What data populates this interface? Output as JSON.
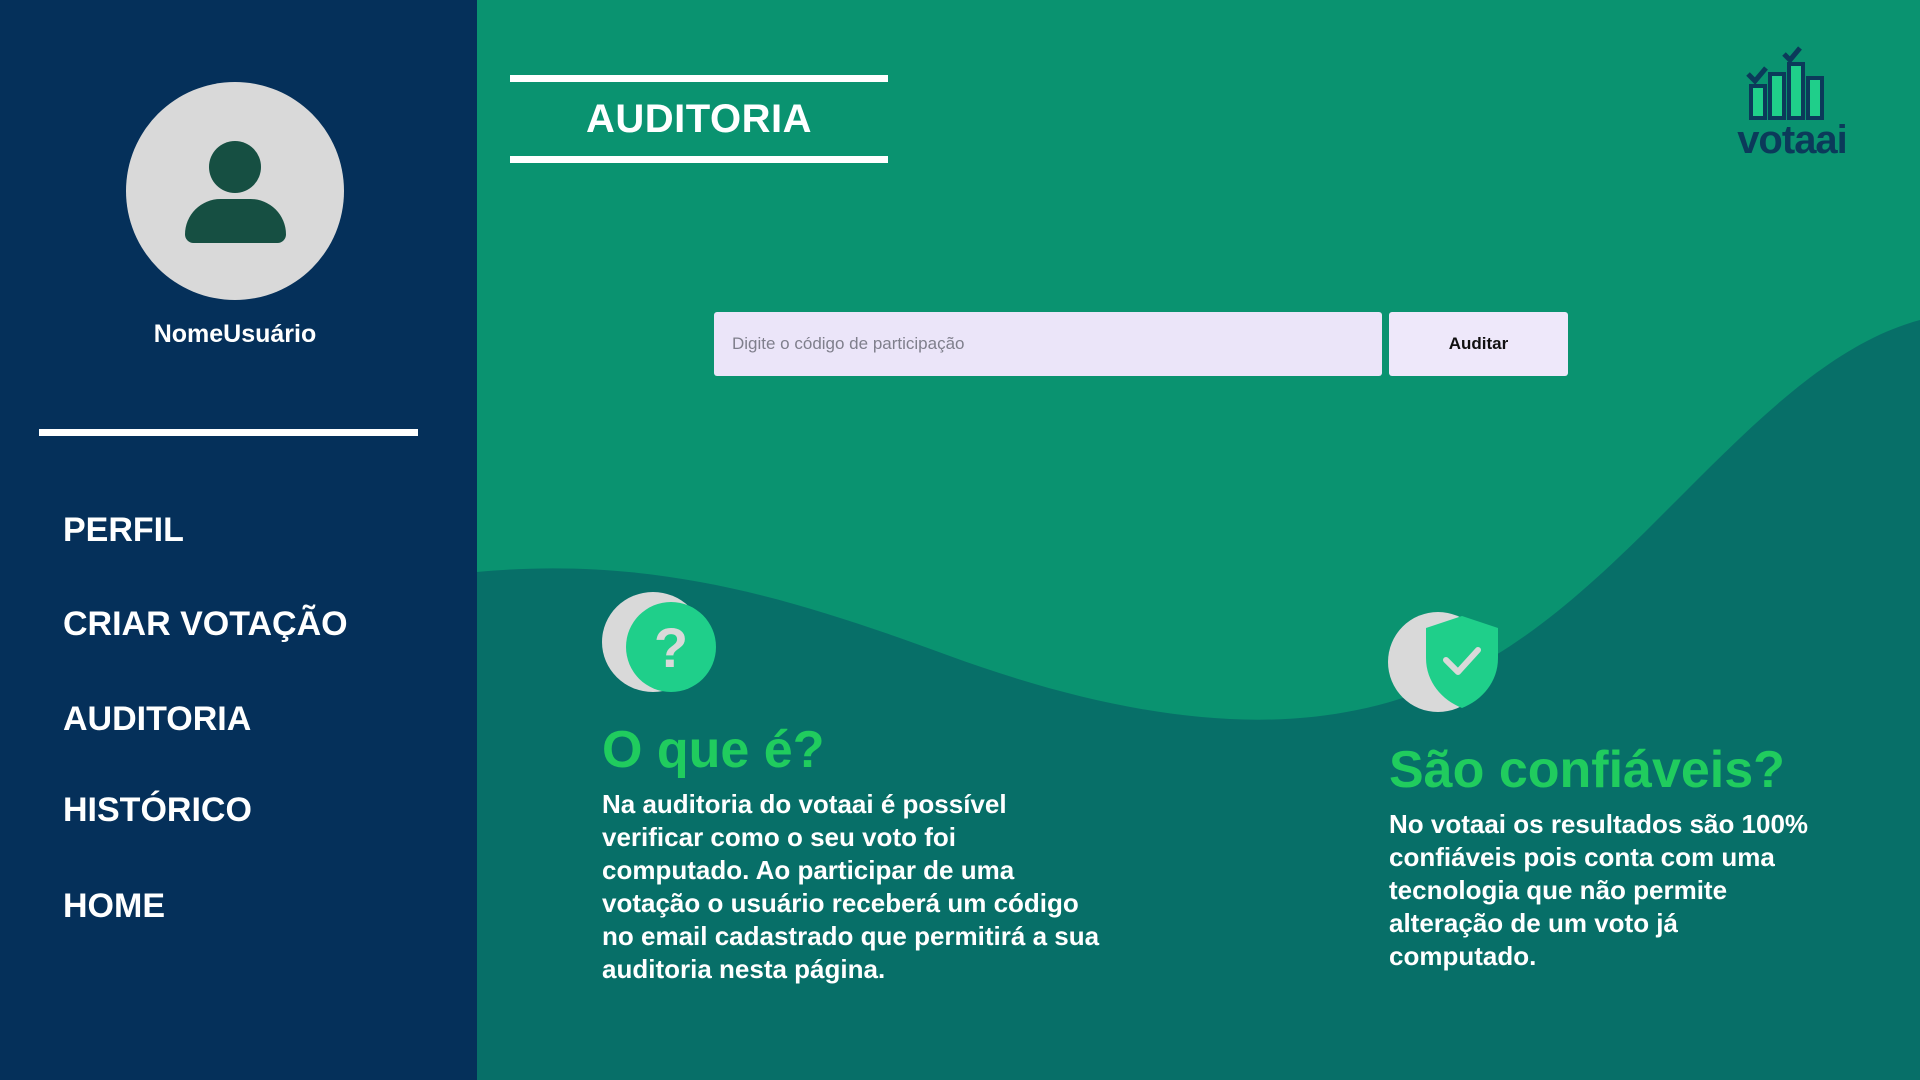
{
  "sidebar": {
    "username": "NomeUsuário",
    "nav": [
      {
        "label": "PERFIL"
      },
      {
        "label": "CRIAR VOTAÇÃO"
      },
      {
        "label": "AUDITORIA"
      },
      {
        "label": "HISTÓRICO"
      },
      {
        "label": "HOME"
      }
    ]
  },
  "header": {
    "title": "AUDITORIA",
    "logo_text": "votaai"
  },
  "search": {
    "placeholder": "Digite o código de participação",
    "value": "",
    "button_label": "Auditar"
  },
  "info": {
    "what": {
      "icon": "question-icon",
      "heading": "O que é?",
      "body": "Na auditoria do votaai é possível verificar como o seu voto foi computado. Ao participar de uma votação o usuário receberá um código no email cadastrado que permitirá a sua auditoria nesta página."
    },
    "trust": {
      "icon": "shield-check-icon",
      "heading": "São confiáveis?",
      "body": "No votaai os resultados são 100% confiáveis pois conta com uma tecnologia que não permite alteração de um voto já computado."
    }
  },
  "colors": {
    "sidebar_bg": "#05305a",
    "main_bg": "#0a9370",
    "wave_bg": "#076f68",
    "accent_green": "#20cc5e",
    "icon_green": "#1fcf8a",
    "input_bg": "#ebe5f9"
  }
}
